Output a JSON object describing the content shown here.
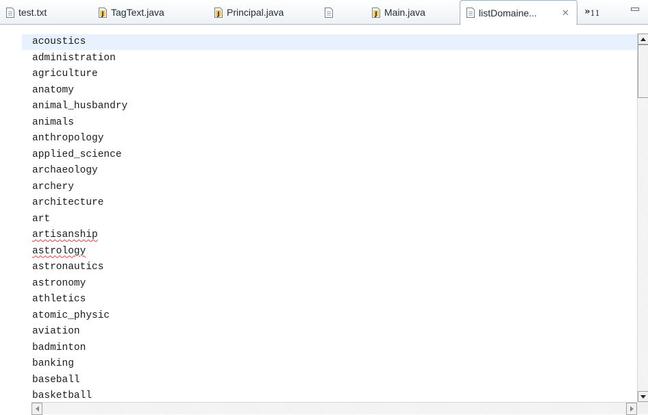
{
  "tabs": [
    {
      "label": "test.txt",
      "icon": "text-file-icon"
    },
    {
      "label": "TagText.java",
      "icon": "java-file-icon"
    },
    {
      "label": "Principal.java",
      "icon": "java-file-icon"
    },
    {
      "label": "",
      "icon": "text-file-icon"
    },
    {
      "label": "Main.java",
      "icon": "java-file-icon"
    },
    {
      "label": "listDomaine...",
      "icon": "text-file-icon",
      "active": true
    }
  ],
  "overflow": {
    "chevron": "»",
    "count": "11"
  },
  "editor": {
    "lines": [
      "acoustics",
      "administration",
      "agriculture",
      "anatomy",
      "animal_husbandry",
      "animals",
      "anthropology",
      "applied_science",
      "archaeology",
      "archery",
      "architecture",
      "art",
      "artisanship",
      "astrology",
      "astronautics",
      "astronomy",
      "athletics",
      "atomic_physic",
      "aviation",
      "badminton",
      "banking",
      "baseball",
      "basketball"
    ]
  },
  "colors": {
    "current_line": "#e8f2fe",
    "spell_error": "#e04040",
    "tab_border": "#9eb0c6"
  }
}
